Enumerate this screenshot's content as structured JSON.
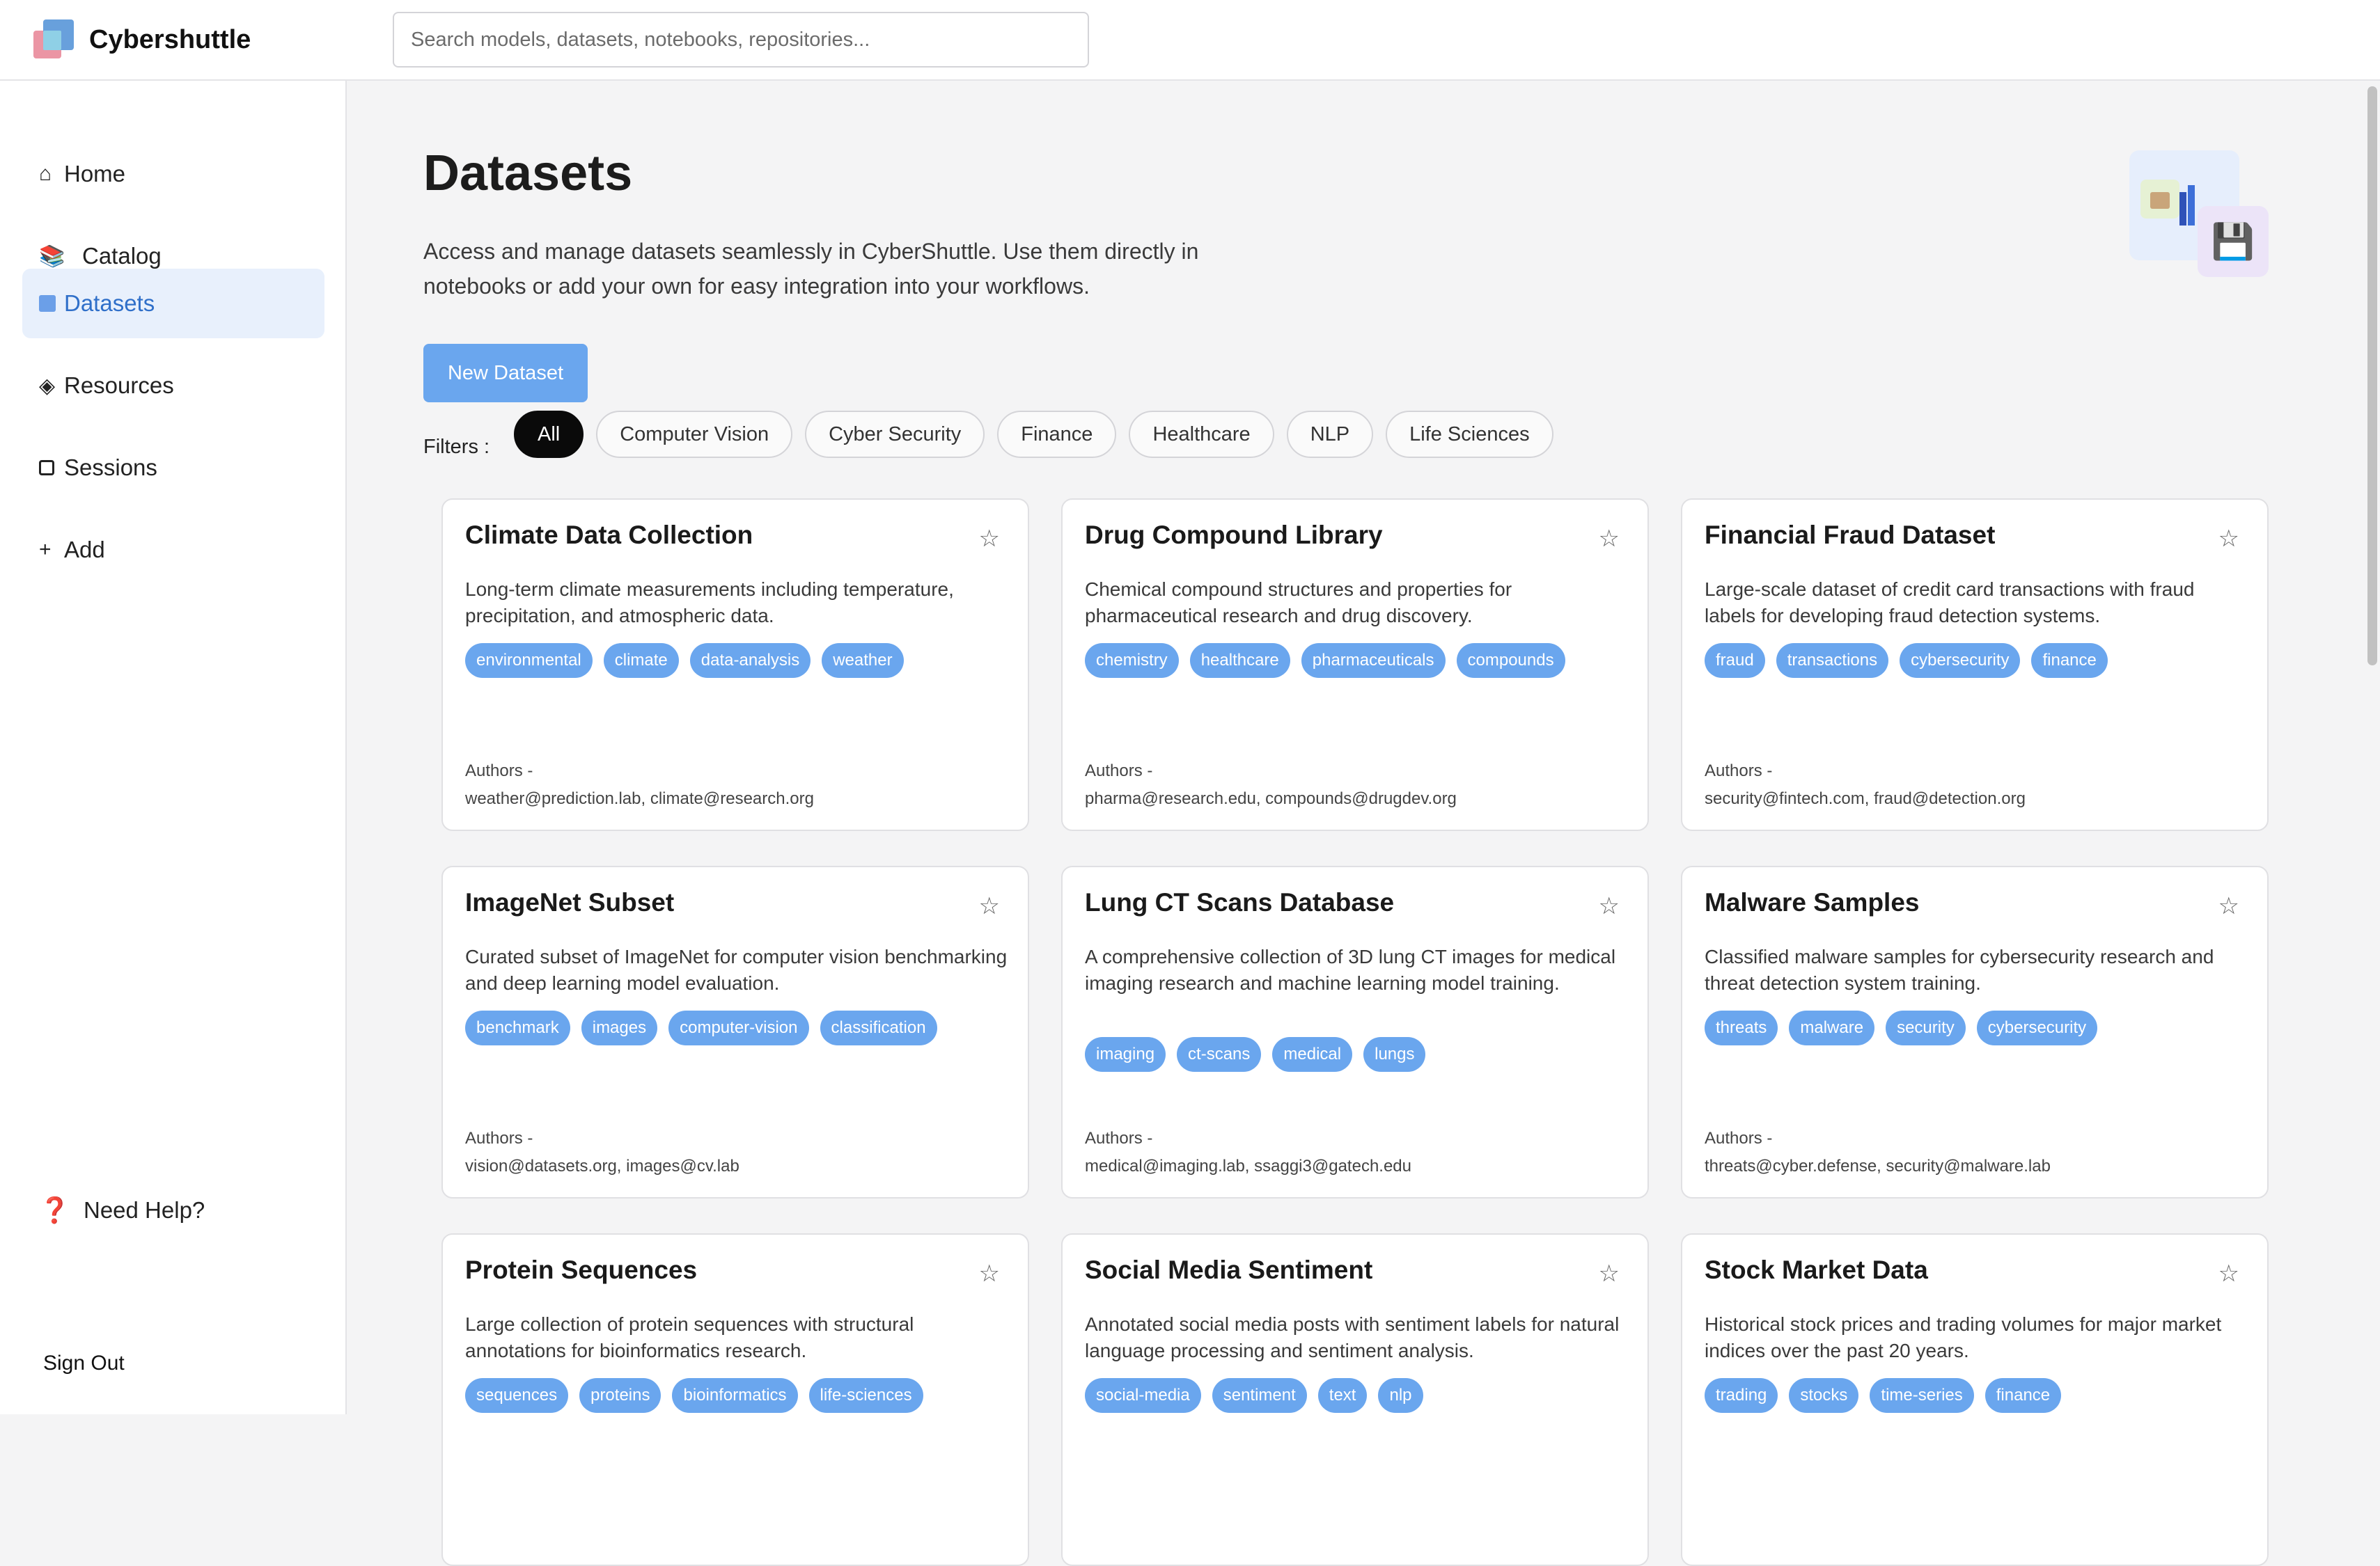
{
  "app": {
    "brand": "Cybershuttle",
    "search_placeholder": "Search models, datasets, notebooks, repositories..."
  },
  "sidebar": {
    "items": [
      {
        "label": "Home",
        "icon": "home-icon",
        "glyph": "⌂"
      },
      {
        "label": "Catalog",
        "icon": "books-icon",
        "glyph": "📚"
      },
      {
        "label": "Datasets",
        "icon": "square-icon",
        "glyph": ""
      },
      {
        "label": "Resources",
        "icon": "diamond-icon",
        "glyph": "◈"
      },
      {
        "label": "Sessions",
        "icon": "square-outline-icon",
        "glyph": ""
      },
      {
        "label": "Add",
        "icon": "plus-icon",
        "glyph": "+"
      }
    ],
    "active": "Datasets",
    "help_label": "Need Help?",
    "help_glyph": "❓",
    "signout_label": "Sign Out"
  },
  "page": {
    "title": "Datasets",
    "description": "Access and manage datasets seamlessly in CyberShuttle. Use them directly in notebooks or add your own for easy integration into your workflows.",
    "new_button": "New Dataset",
    "illustration_glyph": "💾",
    "filters_label": "Filters :",
    "filters": [
      "All",
      "Computer Vision",
      "Cyber Security",
      "Finance",
      "Healthcare",
      "NLP",
      "Life Sciences"
    ],
    "active_filter": "All",
    "authors_label": "Authors -",
    "star_glyph": "☆"
  },
  "cards": [
    {
      "title": "Climate Data Collection",
      "description": "Long-term climate measurements including temperature, precipitation, and atmospheric data.",
      "tags": [
        "environmental",
        "climate",
        "data-analysis",
        "weather"
      ],
      "authors": "weather@prediction.lab, climate@research.org"
    },
    {
      "title": "Drug Compound Library",
      "description": "Chemical compound structures and properties for pharmaceutical research and drug discovery.",
      "tags": [
        "chemistry",
        "healthcare",
        "pharmaceuticals",
        "compounds"
      ],
      "authors": "pharma@research.edu, compounds@drugdev.org"
    },
    {
      "title": "Financial Fraud Dataset",
      "description": "Large-scale dataset of credit card transactions with fraud labels for developing fraud detection systems.",
      "tags": [
        "fraud",
        "transactions",
        "cybersecurity",
        "finance"
      ],
      "authors": "security@fintech.com, fraud@detection.org"
    },
    {
      "title": "ImageNet Subset",
      "description": "Curated subset of ImageNet for computer vision benchmarking and deep learning model evaluation.",
      "tags": [
        "benchmark",
        "images",
        "computer-vision",
        "classification"
      ],
      "authors": "vision@datasets.org, images@cv.lab"
    },
    {
      "title": "Lung CT Scans Database",
      "description": "A comprehensive collection of 3D lung CT images for medical imaging research and machine learning model training.",
      "tags": [
        "imaging",
        "ct-scans",
        "medical",
        "lungs"
      ],
      "authors": "medical@imaging.lab, ssaggi3@gatech.edu"
    },
    {
      "title": "Malware Samples",
      "description": "Classified malware samples for cybersecurity research and threat detection system training.",
      "tags": [
        "threats",
        "malware",
        "security",
        "cybersecurity"
      ],
      "authors": "threats@cyber.defense, security@malware.lab"
    },
    {
      "title": "Protein Sequences",
      "description": "Large collection of protein sequences with structural annotations for bioinformatics research.",
      "tags": [
        "sequences",
        "proteins",
        "bioinformatics",
        "life-sciences"
      ],
      "authors": ""
    },
    {
      "title": "Social Media Sentiment",
      "description": "Annotated social media posts with sentiment labels for natural language processing and sentiment analysis.",
      "tags": [
        "social-media",
        "sentiment",
        "text",
        "nlp"
      ],
      "authors": ""
    },
    {
      "title": "Stock Market Data",
      "description": "Historical stock prices and trading volumes for major market indices over the past 20 years.",
      "tags": [
        "trading",
        "stocks",
        "time-series",
        "finance"
      ],
      "authors": ""
    }
  ],
  "colors": {
    "accent": "#6aa6ee",
    "active_nav_bg": "#e8f0fc",
    "active_nav_text": "#2f6fc9",
    "help_icon": "#d8263a"
  }
}
